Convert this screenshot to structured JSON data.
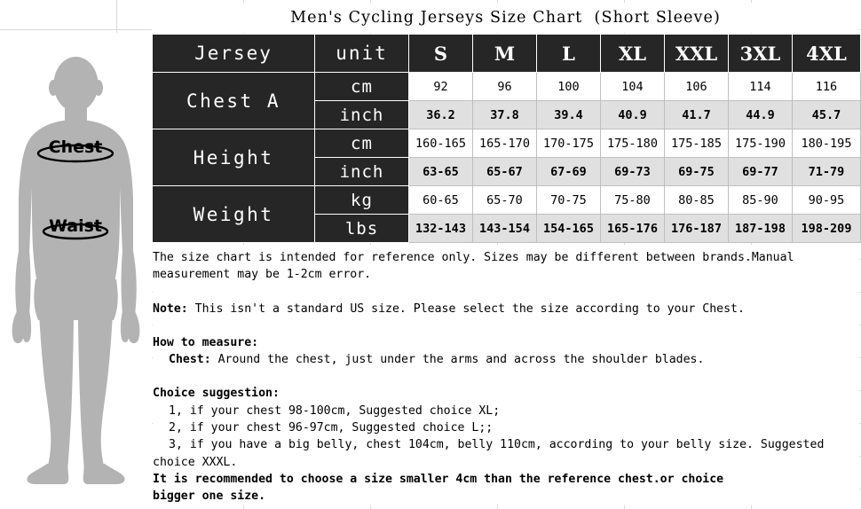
{
  "title": "Men's Cycling Jerseys Size Chart  (Short Sleeve)",
  "figure": {
    "chest_label": "Chest",
    "waist_label": "Waist",
    "body_color": "#b3b3b3"
  },
  "table": {
    "corner_label": "Jersey",
    "unit_header": "unit",
    "sizes": [
      "S",
      "M",
      "L",
      "XL",
      "XXL",
      "3XL",
      "4XL"
    ],
    "rows": [
      {
        "label": "Chest A",
        "units": [
          {
            "unit": "cm",
            "values": [
              "92",
              "96",
              "100",
              "104",
              "106",
              "114",
              "116"
            ]
          },
          {
            "unit": "inch",
            "values": [
              "36.2",
              "37.8",
              "39.4",
              "40.9",
              "41.7",
              "44.9",
              "45.7"
            ]
          }
        ]
      },
      {
        "label": "Height",
        "units": [
          {
            "unit": "cm",
            "values": [
              "160-165",
              "165-170",
              "170-175",
              "175-180",
              "175-185",
              "175-190",
              "180-195"
            ]
          },
          {
            "unit": "inch",
            "values": [
              "63-65",
              "65-67",
              "67-69",
              "69-73",
              "69-75",
              "69-77",
              "71-79"
            ]
          }
        ]
      },
      {
        "label": "Weight",
        "units": [
          {
            "unit": "kg",
            "values": [
              "60-65",
              "65-70",
              "70-75",
              "75-80",
              "80-85",
              "85-90",
              "90-95"
            ]
          },
          {
            "unit": "lbs",
            "values": [
              "132-143",
              "143-154",
              "154-165",
              "165-176",
              "176-187",
              "187-198",
              "198-209"
            ]
          }
        ]
      }
    ]
  },
  "notes": {
    "disclaimer_line1": "The size chart is intended for reference only. Sizes may be different between brands.Manual",
    "disclaimer_line2": "measurement may be 1-2cm error.",
    "note_label": "Note:",
    "note_text": " This isn't a standard US size. Please select the size according to your Chest.",
    "how_to_measure_heading": "How to measure:",
    "chest_label": "Chest:",
    "chest_text": " Around the chest, just under the arms and across the shoulder blades.",
    "choice_heading": "Choice suggestion:",
    "choice_1": "1, if your chest 98-100cm, Suggested choice XL;",
    "choice_2": "2, if your chest 96-97cm, Suggested choice L;;",
    "choice_3a": "3, if you have a big belly, chest 104cm, belly 110cm, according to your belly size. Suggested",
    "choice_3b": "choice XXXL.",
    "recommend_1": "It is recommended to choose a size smaller 4cm than the reference chest.or choice",
    "recommend_2": "bigger one size."
  }
}
